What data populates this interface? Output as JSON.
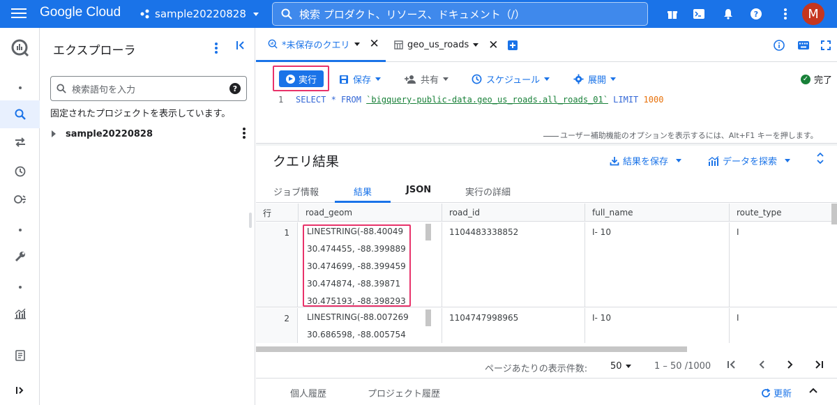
{
  "topbar": {
    "brand": "Google Cloud",
    "project": "sample20220828",
    "search_placeholder": "検索  プロダクト、リソース、ドキュメント（/）",
    "avatar_letter": "M",
    "icons": [
      "menu-icon",
      "gift-icon",
      "cloud-shell-icon",
      "notifications-icon",
      "help-icon",
      "more-vert-icon"
    ]
  },
  "rail": {
    "icons": [
      "bigquery-logo-icon",
      "dot-icon",
      "search-icon",
      "transfer-icon",
      "history-icon",
      "analytics-hub-icon",
      "dot-icon",
      "wrench-icon",
      "dot-icon",
      "insights-icon",
      "release-notes-icon",
      "expand-icon"
    ]
  },
  "explorer": {
    "title": "エクスプローラ",
    "search_placeholder": "検索語句を入力",
    "pinned_text": "固定されたプロジェクトを表示しています。",
    "project": "sample20220828"
  },
  "tabs": {
    "query_tab": "*未保存のクエリ",
    "table_tab": "geo_us_roads"
  },
  "toolbar": {
    "run": "実行",
    "save": "保存",
    "share": "共有",
    "schedule": "スケジュール",
    "deploy": "展開",
    "status": "完了"
  },
  "editor": {
    "line_number": "1",
    "sql_select": "SELECT * FROM ",
    "sql_table": "`bigquery-public-data.geo_us_roads.all_roads_01`",
    "sql_limit": " LIMIT ",
    "sql_limit_value": "1000",
    "a11y_hint": "ユーザー補助機能のオプションを表示するには、Alt+F1 キーを押します。"
  },
  "results": {
    "title": "クエリ結果",
    "save_results": "結果を保存",
    "explore_data": "データを探索",
    "tabs": [
      "ジョブ情報",
      "結果",
      "JSON",
      "実行の詳細"
    ],
    "columns": [
      "行",
      "road_geom",
      "road_id",
      "full_name",
      "route_type"
    ],
    "rows": [
      {
        "row": "1",
        "road_geom": [
          "LINESTRING(-88.40049",
          "30.474455, -88.399889",
          "30.474699, -88.399459",
          "30.474874, -88.39871",
          "30.475193, -88.398293"
        ],
        "road_id": "1104483338852",
        "full_name": "I- 10",
        "route_type": "I"
      },
      {
        "row": "2",
        "road_geom": [
          "LINESTRING(-88.007269",
          "30.686598, -88.005754"
        ],
        "road_id": "1104747998965",
        "full_name": "I- 10",
        "route_type": "I"
      }
    ]
  },
  "pager": {
    "label": "ページあたりの表示件数:",
    "page_size": "50",
    "range": "1 – 50 /1000"
  },
  "history": {
    "personal": "個人履歴",
    "project": "プロジェクト履歴",
    "refresh": "更新"
  },
  "colors": {
    "brand_blue": "#1a73e8",
    "highlight_pink": "#e8326a",
    "success_green": "#188038"
  }
}
